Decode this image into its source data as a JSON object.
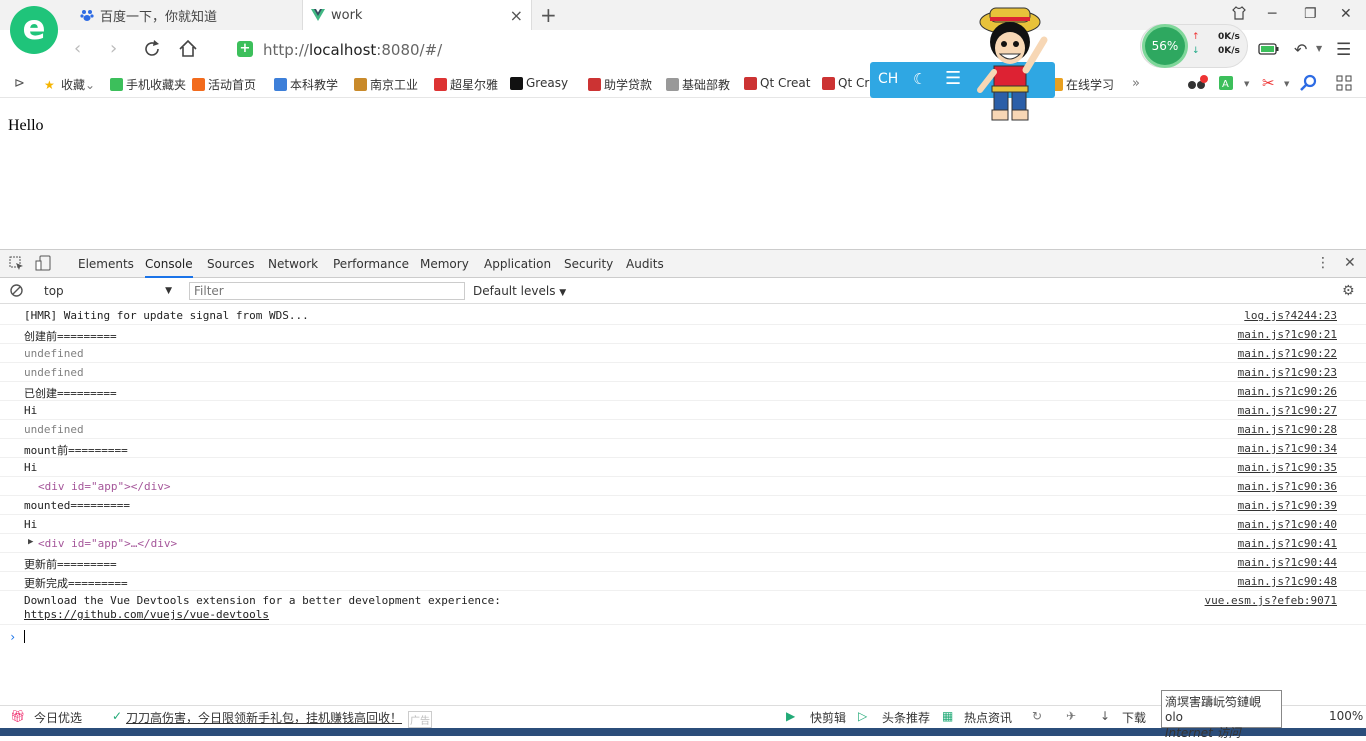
{
  "tabs": [
    {
      "label": "百度一下，你就知道",
      "icon": "baidu-paw-icon",
      "active": false
    },
    {
      "label": "work",
      "icon": "vue-logo-icon",
      "active": true
    }
  ],
  "address": {
    "scheme": "http://",
    "host": "localhost",
    "rest": ":8080/#/"
  },
  "network_widget": {
    "percent": "56%",
    "up": "0K/s",
    "down": "0K/s"
  },
  "bookmarks": [
    {
      "label": "收藏",
      "icon": "star-icon",
      "color": "#f5b400"
    },
    {
      "label": "手机收藏夹",
      "icon": "phone-icon",
      "color": "#3cbf5b"
    },
    {
      "label": "活动首页",
      "icon": "du-icon",
      "color": "#f26b1d"
    },
    {
      "label": "本科教学",
      "icon": "cube-icon",
      "color": "#3d7fd9"
    },
    {
      "label": "南京工业",
      "icon": "pen-icon",
      "color": "#c98a2a"
    },
    {
      "label": "超星尔雅",
      "icon": "chaoxing-icon",
      "color": "#d33"
    },
    {
      "label": "Greasy",
      "icon": "greasy-icon",
      "color": "#111"
    },
    {
      "label": "助学贷款",
      "icon": "loan-icon",
      "color": "#c33"
    },
    {
      "label": "基础部教",
      "icon": "document-icon",
      "color": "#999"
    },
    {
      "label": "Qt Creat",
      "icon": "csdn-icon",
      "color": "#c33"
    },
    {
      "label": "Qt Cr",
      "icon": "csdn-icon",
      "color": "#c33"
    },
    {
      "label": "在线学习",
      "icon": "study-icon",
      "color": "#e8a020"
    }
  ],
  "overlay": {
    "lang": "CH"
  },
  "page": {
    "hello": "Hello"
  },
  "devtools": {
    "tabs": [
      "Elements",
      "Console",
      "Sources",
      "Network",
      "Performance",
      "Memory",
      "Application",
      "Security",
      "Audits"
    ],
    "context": "top",
    "filter_placeholder": "Filter",
    "levels": "Default levels",
    "logs": [
      {
        "msg": "[HMR] Waiting for update signal from WDS...",
        "src": "log.js?4244:23"
      },
      {
        "msg": "创建前=========",
        "src": "main.js?1c90:21"
      },
      {
        "msg": "undefined",
        "src": "main.js?1c90:22"
      },
      {
        "msg": "undefined",
        "src": "main.js?1c90:23"
      },
      {
        "msg": "已创建=========",
        "src": "main.js?1c90:26"
      },
      {
        "msg": "Hi",
        "src": "main.js?1c90:27"
      },
      {
        "msg": "undefined",
        "src": "main.js?1c90:28"
      },
      {
        "msg": "mount前=========",
        "src": "main.js?1c90:34"
      },
      {
        "msg": "Hi",
        "src": "main.js?1c90:35"
      },
      {
        "msg": "<div id=\"app\"></div>",
        "src": "main.js?1c90:36"
      },
      {
        "msg": "mounted=========",
        "src": "main.js?1c90:39"
      },
      {
        "msg": "Hi",
        "src": "main.js?1c90:40"
      },
      {
        "msg": "<div id=\"app\">…</div>",
        "src": "main.js?1c90:41"
      },
      {
        "msg": "更新前=========",
        "src": "main.js?1c90:44"
      },
      {
        "msg": "更新完成=========",
        "src": "main.js?1c90:48"
      },
      {
        "msg": "Download the Vue Devtools extension for a better development experience:",
        "link": "https://github.com/vuejs/vue-devtools",
        "src": "vue.esm.js?efeb:9071"
      }
    ]
  },
  "statusbar": {
    "today": "今日优选",
    "ad": "刀刀高伤害，今日限领新手礼包，挂机赚钱高回收！",
    "ad_badge": "广告",
    "items": [
      "快剪辑",
      "头条推荐",
      "热点资讯",
      "下载"
    ],
    "zoom": "100%"
  },
  "tooltip": {
    "line1": "滴塓害躊岏笉鏈峴olo",
    "line2": "Internet 访问"
  }
}
